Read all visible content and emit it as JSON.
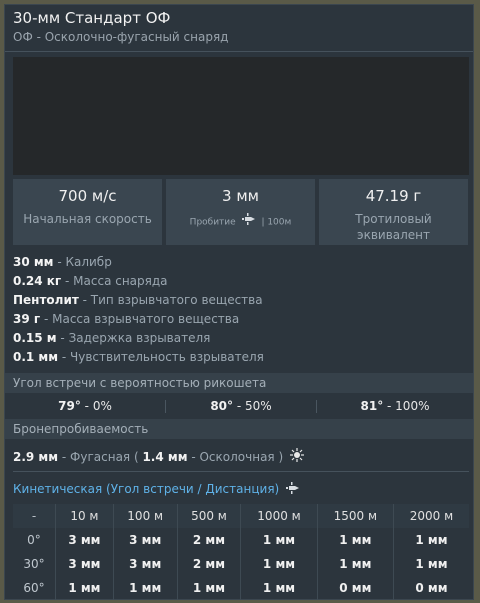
{
  "header": {
    "title": "30-мм Стандарт ОФ",
    "subtitle": "ОФ - Осколочно-фугасный снаряд"
  },
  "stats": [
    {
      "value": "700 м/с",
      "label": "Начальная скорость"
    },
    {
      "value": "3 мм",
      "label_prefix": "Пробитие",
      "label_suffix": "| 100м",
      "icon": "penetration-icon"
    },
    {
      "value": "47.19 г",
      "label": "Тротиловый эквивалент"
    }
  ],
  "properties": [
    {
      "value": "30 мм",
      "label": "Калибр"
    },
    {
      "value": "0.24 кг",
      "label": "Масса снаряда"
    },
    {
      "value": "Пентолит",
      "label": "Тип взрывчатого вещества"
    },
    {
      "value": "39 г",
      "label": "Масса взрывчатого вещества"
    },
    {
      "value": "0.15 м",
      "label": "Задержка взрывателя"
    },
    {
      "value": "0.1 мм",
      "label": "Чувствительность взрывателя"
    }
  ],
  "ricochet": {
    "title": "Угол встречи с вероятностью рикошета",
    "items": [
      {
        "angle": "79°",
        "chance": "0%"
      },
      {
        "angle": "80°",
        "chance": "50%"
      },
      {
        "angle": "81°",
        "chance": "100%"
      }
    ]
  },
  "armor": {
    "title": "Бронепробиваемость",
    "he_value": "2.9 мм",
    "he_label": "Фугасная",
    "frag_value": "1.4 мм",
    "frag_label": "Осколочная",
    "icon": "explosion-icon"
  },
  "kinetic": {
    "title": "Кинетическая (Угол встречи / Дистанция)",
    "icon": "penetration-icon",
    "columns": [
      "-",
      "10 м",
      "100 м",
      "500 м",
      "1000 м",
      "1500 м",
      "2000 м"
    ],
    "rows": [
      [
        "0°",
        "3 мм",
        "3 мм",
        "2 мм",
        "1 мм",
        "1 мм",
        "1 мм"
      ],
      [
        "30°",
        "3 мм",
        "3 мм",
        "2 мм",
        "1 мм",
        "1 мм",
        "1 мм"
      ],
      [
        "60°",
        "1 мм",
        "1 мм",
        "1 мм",
        "1 мм",
        "0 мм",
        "0 мм"
      ]
    ]
  },
  "colors": {
    "panel_bg": "#2c353d",
    "accent_blue": "#5fb2e8",
    "stat_bg": "#3a4650"
  }
}
